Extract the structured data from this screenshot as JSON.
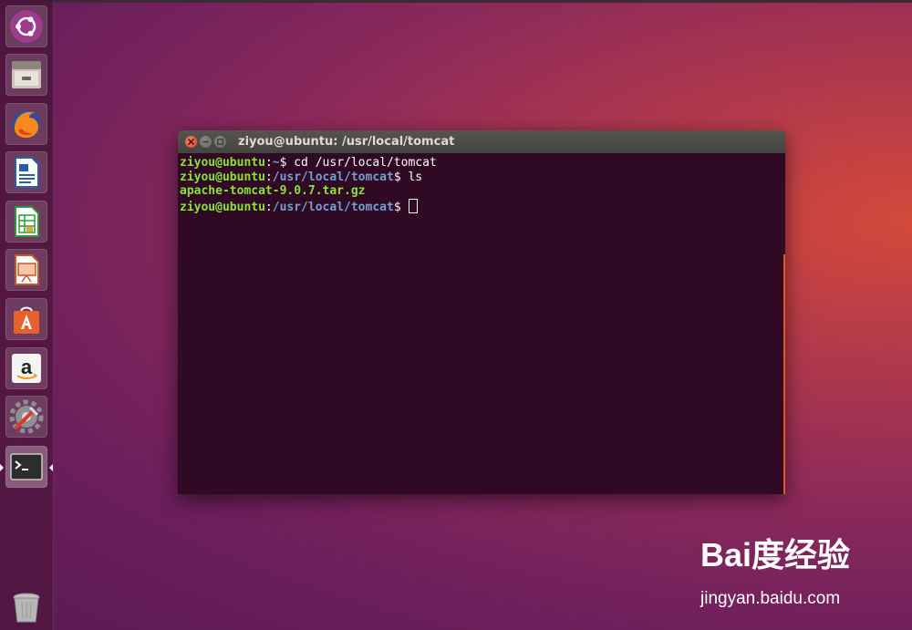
{
  "launcher": {
    "items": [
      {
        "name": "ubuntu-dash-icon"
      },
      {
        "name": "files-icon"
      },
      {
        "name": "firefox-icon"
      },
      {
        "name": "libreoffice-writer-icon"
      },
      {
        "name": "libreoffice-calc-icon"
      },
      {
        "name": "libreoffice-impress-icon"
      },
      {
        "name": "software-center-icon"
      },
      {
        "name": "amazon-icon"
      },
      {
        "name": "system-settings-icon"
      },
      {
        "name": "terminal-icon",
        "active": true
      },
      {
        "name": "trash-icon"
      }
    ]
  },
  "window": {
    "title": "ziyou@ubuntu: /usr/local/tomcat"
  },
  "terminal": {
    "line1": {
      "user": "ziyou@ubuntu",
      "sep": ":",
      "path": "~",
      "prompt": "$ ",
      "command": "cd /usr/local/tomcat"
    },
    "line2": {
      "user": "ziyou@ubuntu",
      "sep": ":",
      "path": "/usr/local/tomcat",
      "prompt": "$ ",
      "command": "ls"
    },
    "line3": {
      "output": "apache-tomcat-9.0.7.tar.gz"
    },
    "line4": {
      "user": "ziyou@ubuntu",
      "sep": ":",
      "path": "/usr/local/tomcat",
      "prompt": "$ "
    }
  },
  "colors": {
    "terminal_bg": "#300a24",
    "prompt_user": "#8ae234",
    "prompt_path": "#729fcf",
    "accent": "#e95420"
  },
  "watermark": {
    "logo": "Bai度经验",
    "url": "jingyan.baidu.com"
  }
}
